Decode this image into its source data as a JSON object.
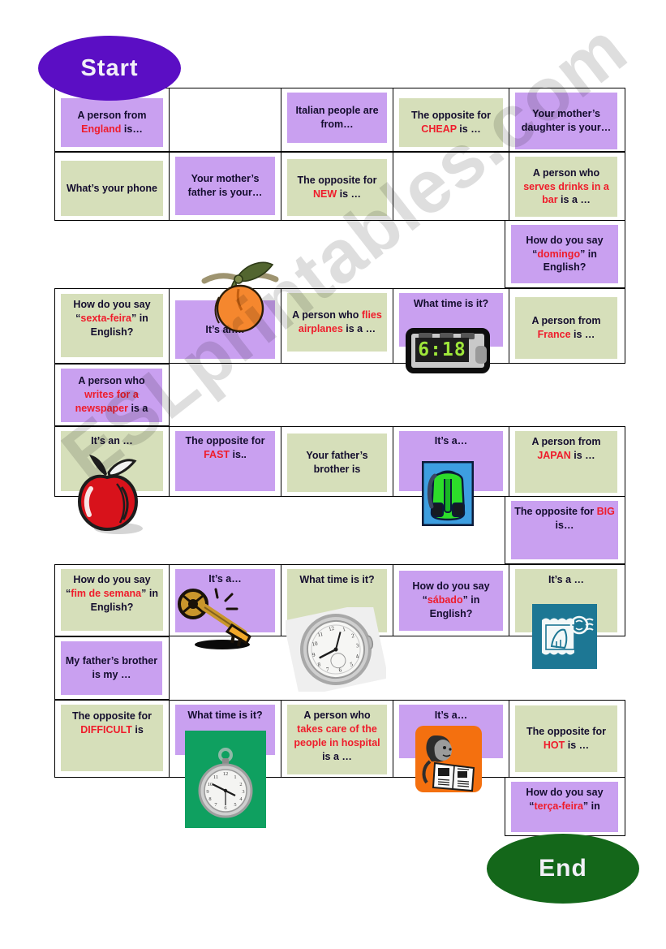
{
  "board": {
    "start_label": "Start",
    "end_label": "End",
    "watermark": "ESLprintables.com",
    "colors": {
      "start_fill": "#5b0ec4",
      "end_fill": "#14671a",
      "purple_tile": "#c9a0f0",
      "green_tile": "#d6dfba",
      "highlight_red": "#ef1c2b",
      "text_dark": "#140d2e"
    }
  },
  "rows": [
    {
      "id": "row-1",
      "cells": [
        {
          "id": "r1c1",
          "color": "purple",
          "align": "bottom",
          "text": "A person from England is…",
          "plain": "A person from ",
          "accent": "England",
          "tail": " is…"
        },
        {
          "id": "r1c2",
          "color": "none",
          "text": ""
        },
        {
          "id": "r1c3",
          "color": "purple",
          "align": "top",
          "text": "Italian people are from…",
          "plain": "Italian people are from…",
          "accent": "",
          "tail": ""
        },
        {
          "id": "r1c4",
          "color": "green",
          "align": "bottom",
          "text": "The opposite for CHEAP is …",
          "plain": "The opposite for ",
          "accent": "CHEAP",
          "tail": " is …"
        },
        {
          "id": "r1c5",
          "color": "purple",
          "align": "top",
          "text": "Your mother’s daughter is your…",
          "plain": "Your mother’s daughter is your…",
          "accent": "",
          "tail": ""
        }
      ]
    },
    {
      "id": "row-2",
      "cells": [
        {
          "id": "r2c1",
          "color": "green",
          "align": "bottom",
          "text": "What’s your phone",
          "plain": "What’s your phone",
          "accent": "",
          "tail": ""
        },
        {
          "id": "r2c2",
          "color": "purple",
          "align": "top",
          "text": "Your mother’s father is your…",
          "plain": "Your mother’s father is your…",
          "accent": "",
          "tail": ""
        },
        {
          "id": "r2c3",
          "color": "green",
          "align": "bottom",
          "text": "The opposite for NEW is …",
          "plain": "The opposite for ",
          "accent": "NEW",
          "tail": " is …"
        },
        {
          "id": "r2c4",
          "color": "none",
          "text": ""
        },
        {
          "id": "r2c5",
          "color": "green",
          "align": "top",
          "text": "A person who serves drinks in a bar is a …",
          "plain": "A person who ",
          "accent": "serves drinks in a bar",
          "tail": " is a …"
        }
      ]
    },
    {
      "id": "row-3",
      "cells": [
        {
          "id": "r3c1",
          "color": "none",
          "text": ""
        },
        {
          "id": "r3c2",
          "color": "none",
          "text": ""
        },
        {
          "id": "r3c3",
          "color": "none",
          "text": ""
        },
        {
          "id": "r3c4",
          "color": "none",
          "text": ""
        },
        {
          "id": "r3c5",
          "color": "purple",
          "align": "mid",
          "text": "How do you say “domingo” in English?",
          "plain": "How do you say “",
          "accent": "domingo",
          "tail": "” in English?"
        }
      ]
    },
    {
      "id": "row-4",
      "cells": [
        {
          "id": "r4c1",
          "color": "green",
          "align": "clip",
          "text": "How do you say “sexta-feira” in English?",
          "plain": "How do you say “",
          "accent": "sexta-feira",
          "tail": "” in English?"
        },
        {
          "id": "r4c2",
          "color": "purple",
          "align": "bottom",
          "text": "It’s an…",
          "plain": "It’s an…",
          "accent": "",
          "tail": ""
        },
        {
          "id": "r4c3",
          "color": "green",
          "align": "top",
          "text": "A person who flies airplanes is a …",
          "plain": "A person who ",
          "accent": "flies airplanes",
          "tail": " is a …"
        },
        {
          "id": "r4c4",
          "color": "purple",
          "align": "top",
          "text": "What time is it?",
          "plain": "What time is it?",
          "accent": "",
          "tail": ""
        },
        {
          "id": "r4c5",
          "color": "green",
          "align": "bottom",
          "text": "A person from France is …",
          "plain": "A person from ",
          "accent": "France",
          "tail": " is …"
        }
      ]
    },
    {
      "id": "row-5",
      "cells": [
        {
          "id": "r5c1",
          "color": "purple",
          "align": "mid",
          "text": "A person who writes for a newspaper is a",
          "plain": "A person who ",
          "accent": "writes for a newspaper",
          "tail": " is a"
        },
        {
          "id": "r5c2",
          "color": "none",
          "text": ""
        },
        {
          "id": "r5c3",
          "color": "none",
          "text": ""
        },
        {
          "id": "r5c4",
          "color": "none",
          "text": ""
        },
        {
          "id": "r5c5",
          "color": "none",
          "text": ""
        }
      ]
    },
    {
      "id": "row-6",
      "cells": [
        {
          "id": "r6c1",
          "color": "green",
          "align": "top",
          "text": "It’s an …",
          "plain": "It’s an …",
          "accent": "",
          "tail": ""
        },
        {
          "id": "r6c2",
          "color": "purple",
          "align": "top",
          "text": "The opposite for FAST is..",
          "plain": "The opposite for ",
          "accent": "FAST",
          "tail": "  is.."
        },
        {
          "id": "r6c3",
          "color": "green",
          "align": "bottom",
          "text": "Your father’s brother is",
          "plain": "Your father’s brother is",
          "accent": "",
          "tail": ""
        },
        {
          "id": "r6c4",
          "color": "purple",
          "align": "top",
          "text": "It’s a…",
          "plain": "It’s a…",
          "accent": "",
          "tail": ""
        },
        {
          "id": "r6c5",
          "color": "green",
          "align": "top",
          "text": "A person from JAPAN is …",
          "plain": "A person from ",
          "accent": "JAPAN",
          "tail": " is …"
        }
      ]
    },
    {
      "id": "row-7",
      "cells": [
        {
          "id": "r7c1",
          "color": "none",
          "text": ""
        },
        {
          "id": "r7c2",
          "color": "none",
          "text": ""
        },
        {
          "id": "r7c3",
          "color": "none",
          "text": ""
        },
        {
          "id": "r7c4",
          "color": "none",
          "text": ""
        },
        {
          "id": "r7c5",
          "color": "purple",
          "align": "top",
          "text": "The opposite for BIG is…",
          "plain": "The opposite for ",
          "accent": "BIG",
          "tail": " is…"
        }
      ]
    },
    {
      "id": "row-8",
      "cells": [
        {
          "id": "r8c1",
          "color": "green",
          "align": "clip",
          "text": "How do you say “fim de semana” in English?",
          "plain": "How do you say “",
          "accent": "fim de semana",
          "tail": "” in English?"
        },
        {
          "id": "r8c2",
          "color": "purple",
          "align": "top",
          "text": "It’s a…",
          "plain": "It’s a…",
          "accent": "",
          "tail": ""
        },
        {
          "id": "r8c3",
          "color": "green",
          "align": "top",
          "text": "What time is it?",
          "plain": "What time is it?",
          "accent": "",
          "tail": ""
        },
        {
          "id": "r8c4",
          "color": "purple",
          "align": "mid",
          "text": "How do you say “sábado” in English?",
          "plain": "How do you say “",
          "accent": "sábado",
          "tail": "” in English?"
        },
        {
          "id": "r8c5",
          "color": "green",
          "align": "top",
          "text": "It’s a …",
          "plain": "It’s a …",
          "accent": "",
          "tail": ""
        }
      ]
    },
    {
      "id": "row-9",
      "cells": [
        {
          "id": "r9c1",
          "color": "purple",
          "align": "mid",
          "text": "My father’s brother is my …",
          "plain": "My father’s brother is my …",
          "accent": "",
          "tail": ""
        },
        {
          "id": "r9c2",
          "color": "none",
          "text": ""
        },
        {
          "id": "r9c3",
          "color": "none",
          "text": ""
        },
        {
          "id": "r9c4",
          "color": "none",
          "text": ""
        },
        {
          "id": "r9c5",
          "color": "none",
          "text": ""
        }
      ]
    },
    {
      "id": "row-10",
      "cells": [
        {
          "id": "r10c1",
          "color": "green",
          "align": "top",
          "text": "The opposite for DIFFICULT is",
          "plain": "The opposite for ",
          "accent": "DIFFICULT",
          "tail": " is"
        },
        {
          "id": "r10c2",
          "color": "purple",
          "align": "top",
          "text": "What time is it?",
          "plain": "What time is it?",
          "accent": "",
          "tail": ""
        },
        {
          "id": "r10c3",
          "color": "green",
          "align": "top",
          "text": "A person who takes care of the people in hospital is a …",
          "plain": "A person who ",
          "accent": "takes care of the people in hospital",
          "tail": " is a …"
        },
        {
          "id": "r10c4",
          "color": "purple",
          "align": "top",
          "text": "It’s a…",
          "plain": "It’s a…",
          "accent": "",
          "tail": ""
        },
        {
          "id": "r10c5",
          "color": "green",
          "align": "mid",
          "text": "The opposite for HOT is …",
          "plain": "The opposite for ",
          "accent": "HOT",
          "tail": " is …"
        }
      ]
    },
    {
      "id": "row-11",
      "cells": [
        {
          "id": "r11c1",
          "color": "none",
          "text": ""
        },
        {
          "id": "r11c2",
          "color": "none",
          "text": ""
        },
        {
          "id": "r11c3",
          "color": "none",
          "text": ""
        },
        {
          "id": "r11c4",
          "color": "none",
          "text": ""
        },
        {
          "id": "r11c5",
          "color": "purple",
          "align": "clip",
          "text": "How do you say “terça-feira” in English?",
          "plain": "How do you say “",
          "accent": "terça-feira",
          "tail": "” in"
        }
      ]
    }
  ],
  "clipart": {
    "orange": "orange-fruit-image",
    "alarm_clock": "digital-alarm-clock-image",
    "alarm_clock_time": "6:18",
    "apple": "red-apple-image",
    "backpack": "green-backpack-image",
    "key": "gold-key-image",
    "pocket_watch": "pocket-watch-image",
    "stamp": "postage-stamp-image",
    "green_clock_card": "pocket-watch-on-green-card-image",
    "newspaper_reader": "person-reading-newspaper-image"
  }
}
